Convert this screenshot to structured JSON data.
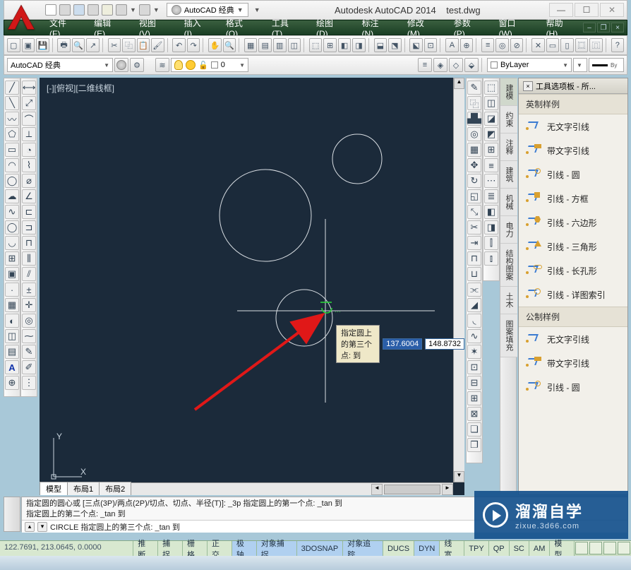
{
  "titlebar": {
    "workspace_label": "AutoCAD 经典",
    "app_title": "Autodesk AutoCAD 2014",
    "doc_title": "test.dwg"
  },
  "menubar": {
    "items": [
      "文件(F)",
      "编辑(E)",
      "视图(V)",
      "插入(I)",
      "格式(O)",
      "工具(T)",
      "绘图(D)",
      "标注(N)",
      "修改(M)",
      "参数(P)",
      "窗口(W)",
      "帮助(H)"
    ]
  },
  "workspace_combo": "AutoCAD 经典",
  "layer_combo_label": "0",
  "linetype_combo": "ByLayer",
  "canvas": {
    "view_label": "[-][俯视][二维线框]",
    "ucs_y": "Y",
    "ucs_x": "X",
    "tabs": [
      "模型",
      "布局1",
      "布局2"
    ]
  },
  "tooltip": {
    "label": "指定圆上的第三个点: 到",
    "val1": "137.6004",
    "val2": "148.8732"
  },
  "palette": {
    "title": "工具选项板 - 所...",
    "group1": "英制样例",
    "group2": "公制样例",
    "items": [
      "无文字引线",
      "带文字引线",
      "引线 - 圆",
      "引线 - 方框",
      "引线 - 六边形",
      "引线 - 三角形",
      "引线 - 长孔形",
      "引线 - 详图索引"
    ],
    "items2": [
      "无文字引线",
      "带文字引线",
      "引线 - 圆"
    ],
    "acctabs": [
      "建模",
      "约束",
      "注释",
      "建筑",
      "机械",
      "电力",
      "结构图案",
      "土木",
      "图案填充"
    ]
  },
  "command": {
    "hist1": "指定圆的圆心或 [三点(3P)/两点(2P)/切点、切点、半径(T)]: _3p 指定圆上的第一个点: _tan 到",
    "hist2": "指定圆上的第二个点: _tan 到",
    "line": "CIRCLE 指定圆上的第三个点: _tan 到"
  },
  "status": {
    "coords": "122.7691, 213.0645, 0.0000",
    "buttons": [
      "推断",
      "捕捉",
      "栅格",
      "正交",
      "极轴",
      "对象捕捉",
      "3DOSNAP",
      "对象追踪",
      "DUCS",
      "DYN",
      "线宽",
      "TPY",
      "QP",
      "SC",
      "AM"
    ],
    "on": {
      "4": true,
      "5": true,
      "6": true,
      "7": true,
      "9": true
    }
  },
  "watermark": {
    "line1": "溜溜自学",
    "line2": "zixue.3d66.com"
  },
  "chart_data": {
    "type": "diagram",
    "note": "AutoCAD drawing canvas with three circles, crosshair cursor, and a red annotation arrow. No quantitative chart."
  }
}
